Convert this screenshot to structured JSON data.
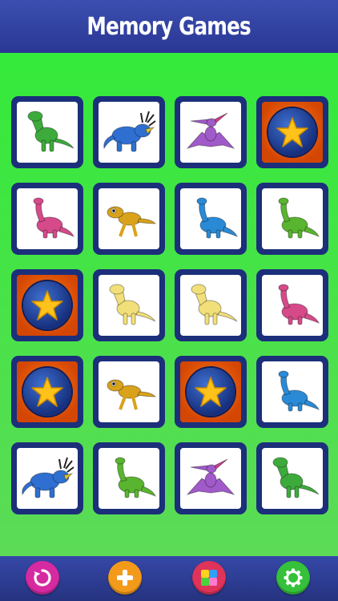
{
  "header": {
    "title": "Memory Games"
  },
  "cards": [
    {
      "state": "face",
      "animal": "t-rex-green"
    },
    {
      "state": "face",
      "animal": "styracosaurus-blue"
    },
    {
      "state": "face",
      "animal": "pteranodon-purple"
    },
    {
      "state": "back",
      "animal": "star-coin"
    },
    {
      "state": "face",
      "animal": "sauropod-pink"
    },
    {
      "state": "face",
      "animal": "raptor-yellow"
    },
    {
      "state": "face",
      "animal": "sauropod-blue"
    },
    {
      "state": "face",
      "animal": "sauropod-green"
    },
    {
      "state": "back",
      "animal": "star-coin"
    },
    {
      "state": "face",
      "animal": "t-rex-yellow"
    },
    {
      "state": "face",
      "animal": "t-rex-yellow"
    },
    {
      "state": "face",
      "animal": "sauropod-pink"
    },
    {
      "state": "back",
      "animal": "star-coin"
    },
    {
      "state": "face",
      "animal": "raptor-yellow"
    },
    {
      "state": "back",
      "animal": "star-coin"
    },
    {
      "state": "face",
      "animal": "sauropod-blue"
    },
    {
      "state": "face",
      "animal": "styracosaurus-blue"
    },
    {
      "state": "face",
      "animal": "sauropod-green"
    },
    {
      "state": "face",
      "animal": "pteranodon-purple"
    },
    {
      "state": "face",
      "animal": "t-rex-green"
    }
  ],
  "colors": {
    "t-rex-green": "#3dab3c",
    "styracosaurus-blue": "#2f6fd1",
    "pteranodon-purple": "#a15ac9",
    "sauropod-pink": "#d64a8a",
    "raptor-yellow": "#d9a21a",
    "sauropod-blue": "#2a8ad6",
    "sauropod-green": "#59b52f",
    "t-rex-yellow": "#f1df7a",
    "star": "#ffc21a"
  },
  "footer": {
    "buttons": [
      {
        "name": "restart-button",
        "icon": "restart-icon",
        "color": "#d62aa1"
      },
      {
        "name": "add-button",
        "icon": "plus-icon",
        "color": "#f39a1a"
      },
      {
        "name": "theme-button",
        "icon": "palette-icon",
        "color": "#e0335a"
      },
      {
        "name": "settings-button",
        "icon": "gear-icon",
        "color": "#35c13a"
      }
    ]
  }
}
